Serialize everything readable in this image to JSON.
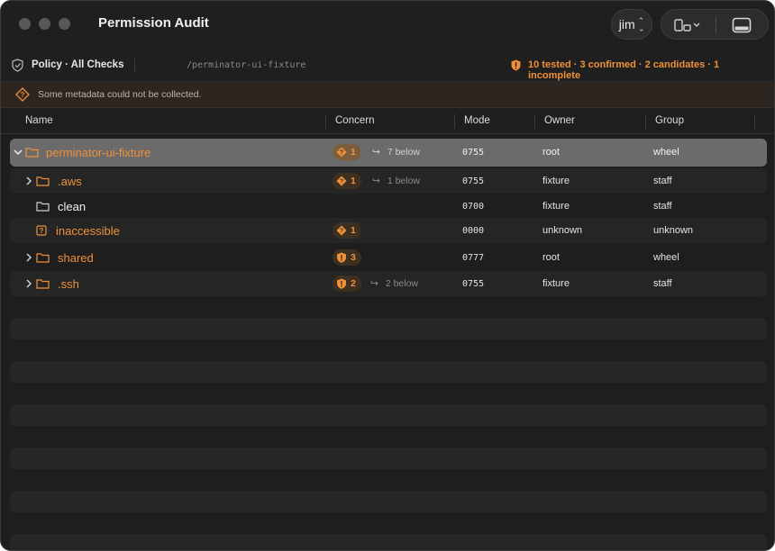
{
  "window": {
    "title": "Permission Audit"
  },
  "user_button": {
    "label": "jim"
  },
  "toolbar": {
    "policy_label": "Policy · All Checks",
    "path": "/perminator-ui-fixture",
    "stats": "10 tested · 3 confirmed · 2 candidates · 1 incomplete"
  },
  "banner": {
    "text": "Some metadata could not be collected."
  },
  "columns": {
    "name": "Name",
    "concern": "Concern",
    "mode": "Mode",
    "owner": "Owner",
    "group": "Group"
  },
  "rows": [
    {
      "name": "perminator-ui-fixture",
      "concern_count": "1",
      "below": "7 below",
      "mode": "0755",
      "owner": "root",
      "group": "wheel",
      "icon": "folder-icon",
      "badge_icon": "diamond-question-icon"
    },
    {
      "name": ".aws",
      "concern_count": "1",
      "below": "1 below",
      "mode": "0755",
      "owner": "fixture",
      "group": "staff",
      "icon": "folder-icon",
      "badge_icon": "diamond-question-icon"
    },
    {
      "name": "clean",
      "concern_count": "",
      "below": "",
      "mode": "0700",
      "owner": "fixture",
      "group": "staff",
      "icon": "folder-icon",
      "badge_icon": ""
    },
    {
      "name": "inaccessible",
      "concern_count": "1",
      "below": "",
      "mode": "0000",
      "owner": "unknown",
      "group": "unknown",
      "icon": "question-square-icon",
      "badge_icon": "diamond-question-icon"
    },
    {
      "name": "shared",
      "concern_count": "3",
      "below": "",
      "mode": "0777",
      "owner": "root",
      "group": "wheel",
      "icon": "folder-icon",
      "badge_icon": "shield-exclamation-icon"
    },
    {
      "name": ".ssh",
      "concern_count": "2",
      "below": "2 below",
      "mode": "0755",
      "owner": "fixture",
      "group": "staff",
      "icon": "folder-icon",
      "badge_icon": "shield-exclamation-icon"
    }
  ],
  "colors": {
    "accent": "#f0913a",
    "background": "#1e1e1e",
    "selected_row": "#6b6b6b"
  }
}
